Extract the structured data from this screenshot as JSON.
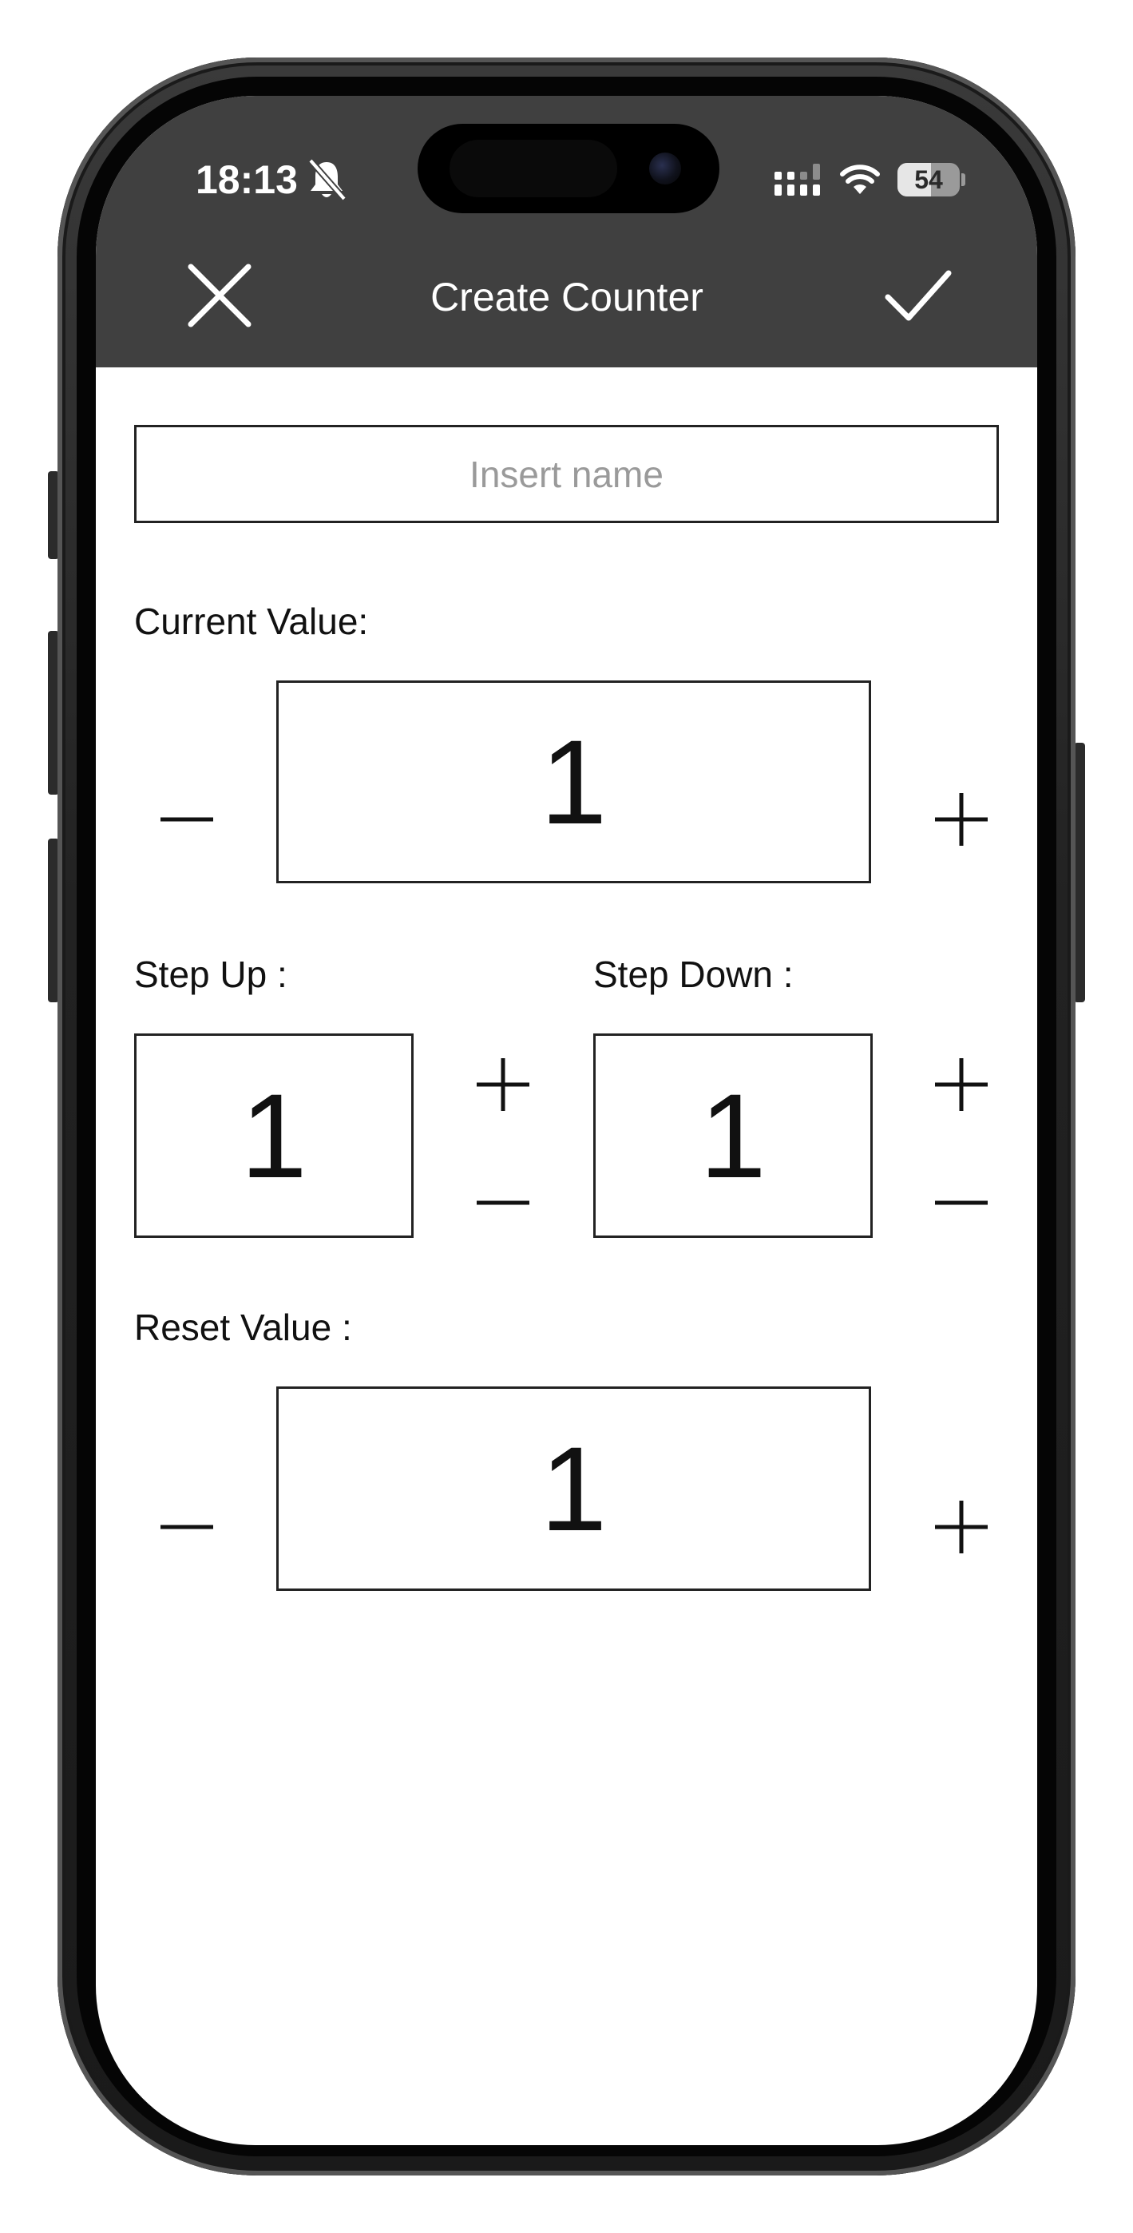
{
  "status_bar": {
    "time": "18:13",
    "battery_percent": "54",
    "battery_level": 0.54
  },
  "header": {
    "title": "Create Counter",
    "close_icon": "close-icon",
    "confirm_icon": "checkmark-icon",
    "background_color": "#404040"
  },
  "name_field": {
    "placeholder": "Insert name",
    "value": ""
  },
  "current_value": {
    "label": "Current Value:",
    "value": "1"
  },
  "step_up": {
    "label": "Step Up :",
    "value": "1"
  },
  "step_down": {
    "label": "Step Down :",
    "value": "1"
  },
  "reset_value": {
    "label": "Reset Value :",
    "value": "1"
  }
}
